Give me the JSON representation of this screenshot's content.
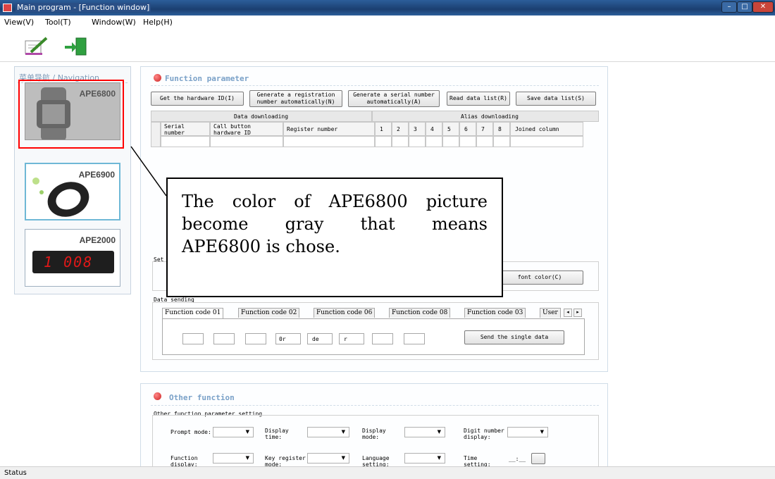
{
  "window": {
    "title": "Main program - [Function window]"
  },
  "menu": [
    {
      "label": "View(V)"
    },
    {
      "label": "Tool(T)"
    },
    {
      "label": "Window(W)"
    },
    {
      "label": "Help(H)"
    }
  ],
  "sidebar": {
    "header": "菜单导航 / Navigation",
    "products": [
      {
        "name": "APE6800",
        "selected": true
      },
      {
        "name": "APE6900"
      },
      {
        "name": "APE2000",
        "display": "1 008"
      }
    ]
  },
  "function_param": {
    "title": "Function parameter",
    "buttons": {
      "hw_id": "Get the hardware ID(I)",
      "reg_auto": "Generate a registration number automatically(N)",
      "serial_auto": "Generate a serial number automatically(A)",
      "read_list": "Read data list(R)",
      "save_list": "Save data list(S)"
    },
    "group_headers": {
      "left": "Data downloading",
      "right": "Alias downloading"
    },
    "columns": [
      "Serial number",
      "Call button hardware ID",
      "Register number",
      "1",
      "2",
      "3",
      "4",
      "5",
      "6",
      "7",
      "8",
      "Joined column"
    ],
    "set_label": "Set",
    "font_color_btn": "font color(C)"
  },
  "data_sending": {
    "label": "Data sending",
    "tabs": [
      "Function code 01",
      "Function code 02",
      "Function code 06",
      "Function code 08",
      "Function code 03",
      "User"
    ],
    "fields": [
      "",
      "",
      "",
      "0r",
      "de",
      "r",
      "",
      ""
    ],
    "send_btn": "Send the single data"
  },
  "other": {
    "title": "Other function",
    "group": "Other function parameter setting",
    "labels": {
      "prompt": "Prompt mode:",
      "display_time": "Display time:",
      "display_mode": "Display mode:",
      "digit": "Digit number display:",
      "func_display": "Function display:",
      "key_reg": "Key register mode:",
      "lang": "Language setting:",
      "time": "Time setting:"
    },
    "time_value": "__:__"
  },
  "callout": {
    "line1": "The color of APE6800 picture",
    "line2": "become gray that means",
    "line3": "APE6800 is chose."
  },
  "status": "Status",
  "colors": {
    "title_bar": "#1b3f70",
    "highlight": "#ff0000",
    "section": "#7aa1c8"
  }
}
